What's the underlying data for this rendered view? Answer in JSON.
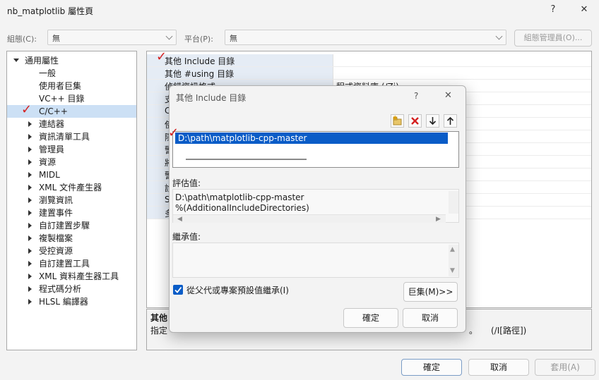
{
  "window": {
    "title": "nb_matplotlib 屬性頁",
    "help_glyph": "?",
    "close_glyph": "✕"
  },
  "topbar": {
    "config_label": "組態(C):",
    "config_value": "無",
    "platform_label": "平台(P):",
    "platform_value": "無",
    "config_manager_label": "組態管理員(O)..."
  },
  "tree": {
    "root": "通用屬性",
    "items": [
      "一般",
      "使用者巨集",
      "VC++ 目錄",
      "C/C++",
      "連結器",
      "資訊清單工具",
      "管理員",
      "資源",
      "MIDL",
      "XML 文件產生器",
      "瀏覽資訊",
      "建置事件",
      "自訂建置步驟",
      "複製檔案",
      "受控資源",
      "自訂建置工具",
      "XML 資料產生器工具",
      "程式碼分析",
      "HLSL 編譯器"
    ]
  },
  "grid": {
    "rows": [
      {
        "key": "其他 Include 目錄",
        "value": ""
      },
      {
        "key": "其他 #using 目錄",
        "value": ""
      },
      {
        "key": "偵錯資訊格式",
        "value": "程式資料庫 (/Zi)"
      },
      {
        "key": "支",
        "value": ""
      },
      {
        "key": "C",
        "value": ""
      },
      {
        "key": "使",
        "value": ""
      },
      {
        "key": "隱",
        "value": ""
      },
      {
        "key": "警",
        "value": ""
      },
      {
        "key": "將",
        "value": ""
      },
      {
        "key": "警",
        "value": ""
      },
      {
        "key": "診",
        "value": ""
      },
      {
        "key": "S",
        "value": ""
      },
      {
        "key": "多",
        "value": ""
      }
    ]
  },
  "description": {
    "title": "其他",
    "text_left": "指定",
    "text_right": "。",
    "switch": "(/I[路徑])"
  },
  "dialog": {
    "title": "其他 Include 目錄",
    "help_glyph": "?",
    "close_glyph": "✕",
    "entry": "D:\\path\\matplotlib-cpp-master",
    "evaluated_label": "評估值:",
    "evaluated_lines": [
      "D:\\path\\matplotlib-cpp-master",
      "%(AdditionalIncludeDirectories)"
    ],
    "inherited_label": "繼承值:",
    "inherit_checkbox_label": "從父代或專案預設值繼承(I)",
    "macros_label": "巨集(M)>>",
    "ok_label": "確定",
    "cancel_label": "取消"
  },
  "footer": {
    "ok_label": "確定",
    "cancel_label": "取消",
    "apply_label": "套用(A)"
  },
  "colors": {
    "selection": "#0a5cc7",
    "tree_selected": "#cce0f5",
    "delete_red": "#d42020",
    "annotation_red": "#d42020"
  }
}
